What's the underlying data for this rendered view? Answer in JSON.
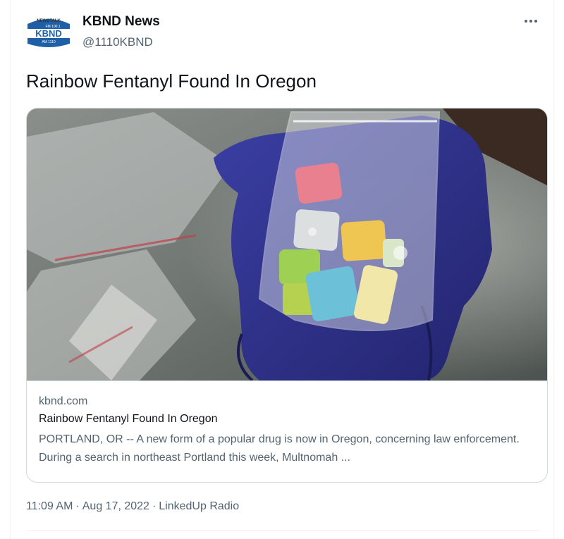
{
  "author": {
    "name": "KBND News",
    "handle": "@1110KBND",
    "avatar_lines": [
      "NEWSTALK",
      "FM 100.1",
      "KBND",
      "AM 1110"
    ]
  },
  "more_icon": "more-horizontal-icon",
  "tweet": {
    "text": "Rainbow Fentanyl Found In Oregon"
  },
  "card": {
    "domain": "kbnd.com",
    "title": "Rainbow Fentanyl Found In Oregon",
    "description": "PORTLAND, OR -- A new form of a popular drug is now in Oregon, concerning law enforcement. During a search in northeast Portland this week, Multnomah ..."
  },
  "meta": {
    "time": "11:09 AM",
    "date": "Aug 17, 2022",
    "source": "LinkedUp Radio"
  },
  "colors": {
    "text_primary": "#0f1419",
    "text_secondary": "#536471",
    "border": "#cfd9de",
    "logo_blue": "#1f5fa8"
  }
}
